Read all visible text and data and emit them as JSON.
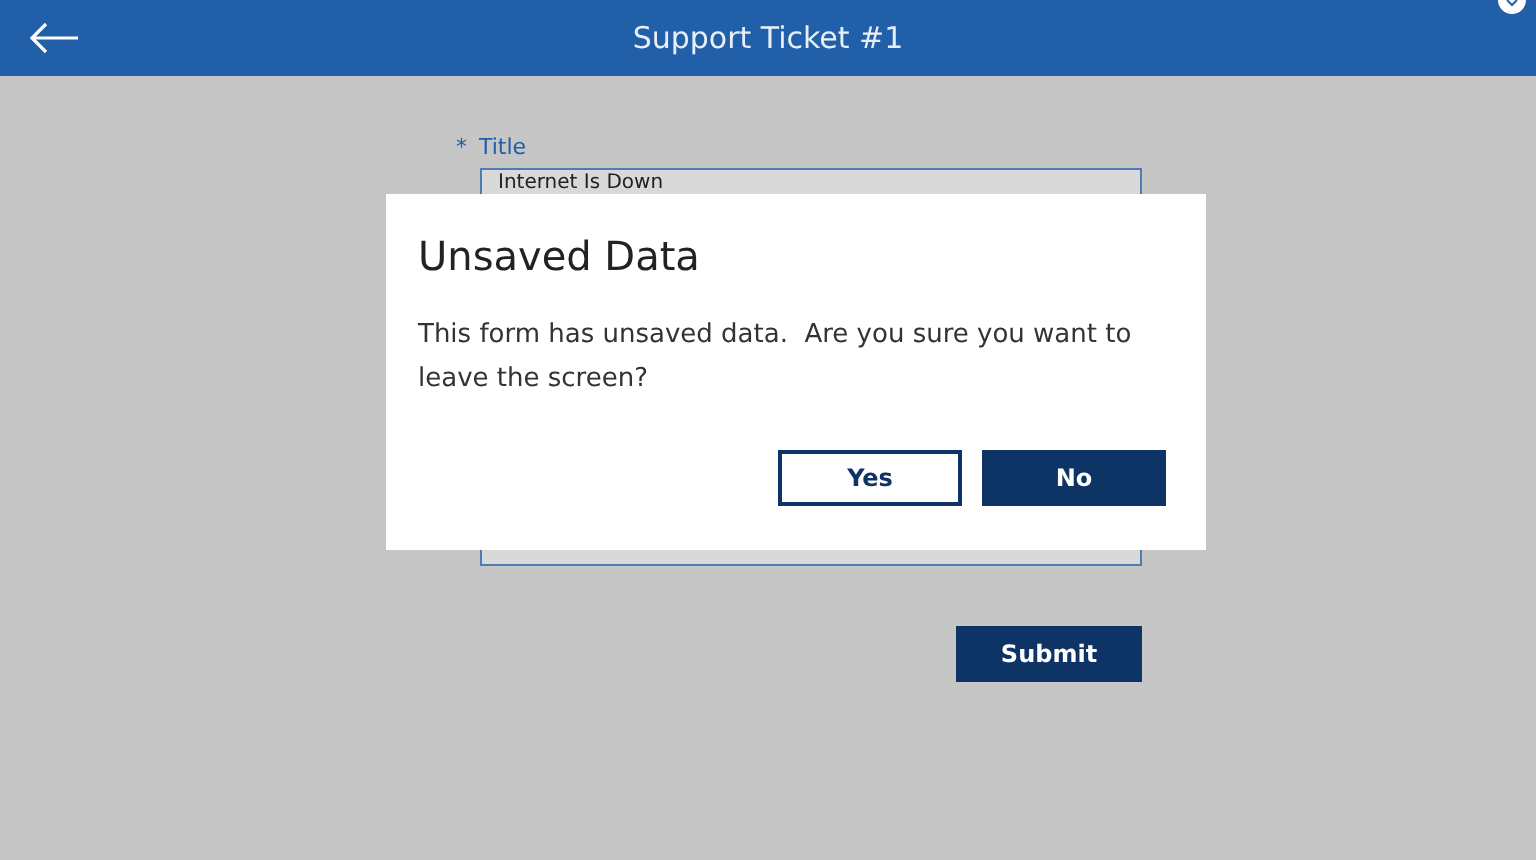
{
  "header": {
    "title": "Support Ticket #1"
  },
  "form": {
    "required_mark": "*",
    "label": "Title",
    "value": "Internet Is Down",
    "submit": "Submit"
  },
  "dialog": {
    "title": "Unsaved Data",
    "message": "This form has unsaved data.  Are you sure you want to leave the screen?",
    "buttons": [
      {
        "label": "Yes",
        "kind": "secondary"
      },
      {
        "label": "No",
        "kind": "primary"
      }
    ]
  }
}
